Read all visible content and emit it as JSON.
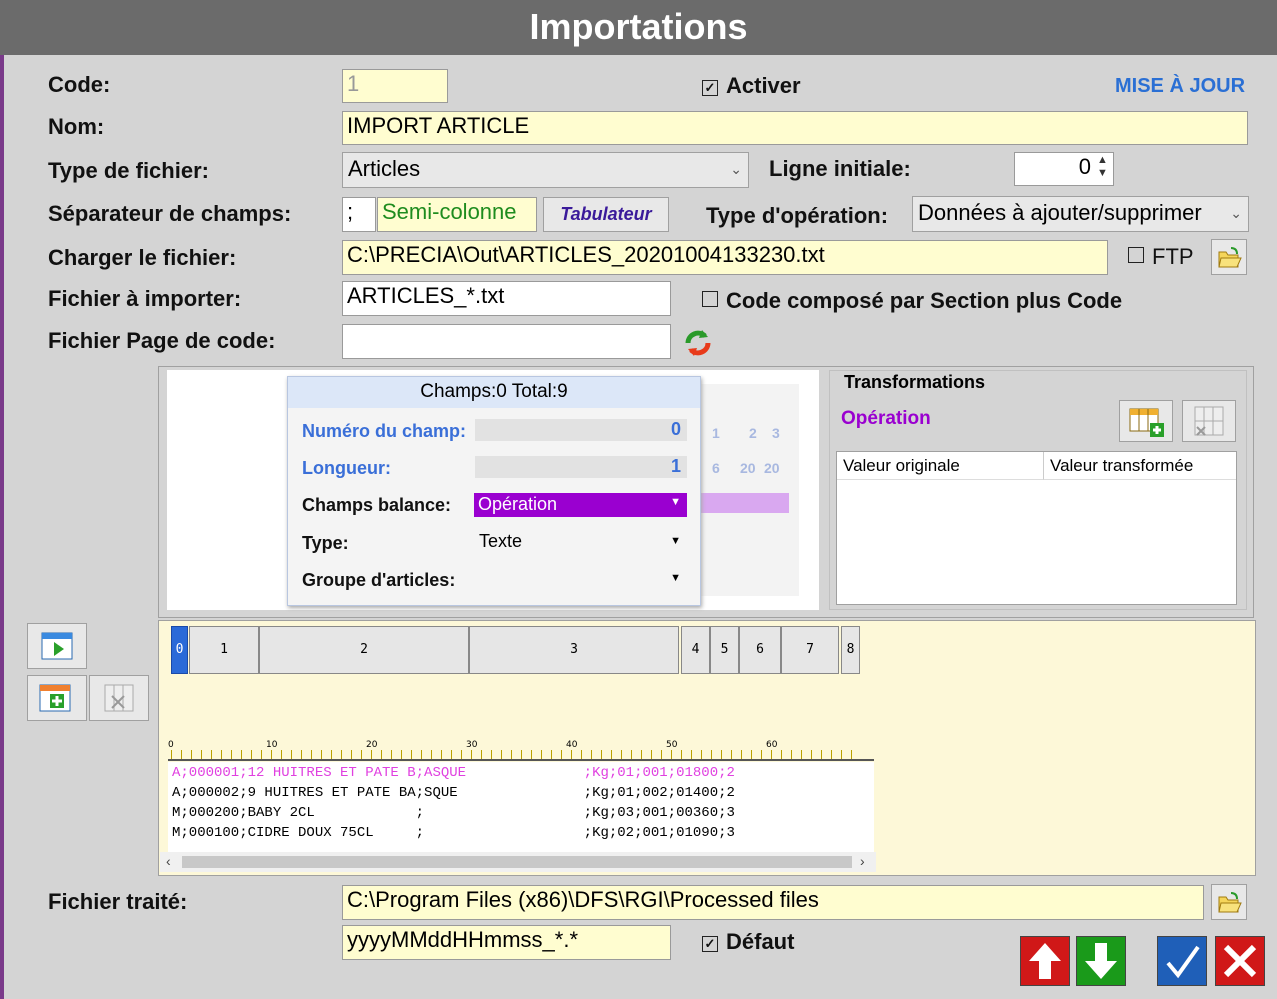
{
  "title": "Importations",
  "labels": {
    "code": "Code:",
    "nom": "Nom:",
    "type_fichier": "Type de fichier:",
    "ligne_initiale": "Ligne initiale:",
    "separateur": "Séparateur de champs:",
    "type_operation": "Type d'opération:",
    "charger": "Charger le fichier:",
    "fichier_importer": "Fichier à importer:",
    "page_code": "Fichier Page de code:",
    "fichier_traite": "Fichier traité:"
  },
  "values": {
    "code": "1",
    "nom": "IMPORT ARTICLE",
    "type_fichier": "Articles",
    "ligne_initiale": "0",
    "separateur_char": ";",
    "separateur_name": "Semi-colonne",
    "tabulateur": "Tabulateur",
    "type_operation": "Données à ajouter/supprimer",
    "charger": "C:\\PRECIA\\Out\\ARTICLES_20201004133230.txt",
    "fichier_importer": "ARTICLES_*.txt",
    "page_code": "",
    "fichier_traite": "C:\\Program Files (x86)\\DFS\\RGI\\Processed files",
    "pattern": "yyyyMMddHHmmss_*.*"
  },
  "checks": {
    "activer": "Activer",
    "ftp": "FTP",
    "code_compose": "Code composé par Section plus Code",
    "defaut": "Défaut"
  },
  "mise_a_jour": "MISE À JOUR",
  "popup": {
    "header": "Champs:0  Total:9",
    "numero_label": "Numéro du champ:",
    "numero_value": "0",
    "longueur_label": "Longueur:",
    "longueur_value": "1",
    "balance_label": "Champs balance:",
    "balance_value": "Opération",
    "type_label": "Type:",
    "type_value": "Texte",
    "groupe_label": "Groupe d'articles:",
    "ghost_nums": [
      "1",
      "2",
      "3"
    ],
    "ghost_lens": [
      "6",
      "20",
      "20"
    ]
  },
  "transformations": {
    "title": "Transformations",
    "operation": "Opération",
    "col1": "Valeur originale",
    "col2": "Valeur transformée"
  },
  "columns": [
    "0",
    "1",
    "2",
    "3",
    "4",
    "5",
    "6",
    "7",
    "8"
  ],
  "ruler": [
    "0",
    "10",
    "20",
    "30",
    "40",
    "50",
    "60"
  ],
  "lines": [
    "A;000001;12 HUITRES ET PATE B;ASQUE              ;Kg;01;001;01800;2",
    "A;000002;9 HUITRES ET PATE BA;SQUE               ;Kg;01;002;01400;2",
    "M;000200;BABY 2CL            ;                   ;Kg;03;001;00360;3",
    "M;000100;CIDRE DOUX 75CL     ;                   ;Kg;02;001;01090;3"
  ],
  "icons": [
    "open-folder-icon",
    "refresh-icon",
    "add-grid-icon",
    "delete-grid-icon",
    "run-icon",
    "arrow-up-icon",
    "arrow-down-icon",
    "check-icon",
    "close-icon"
  ],
  "colors": {
    "accent_purple": "#9a00d0",
    "field_yellow": "#fffdd0",
    "highlight_line": "#e040e0"
  }
}
